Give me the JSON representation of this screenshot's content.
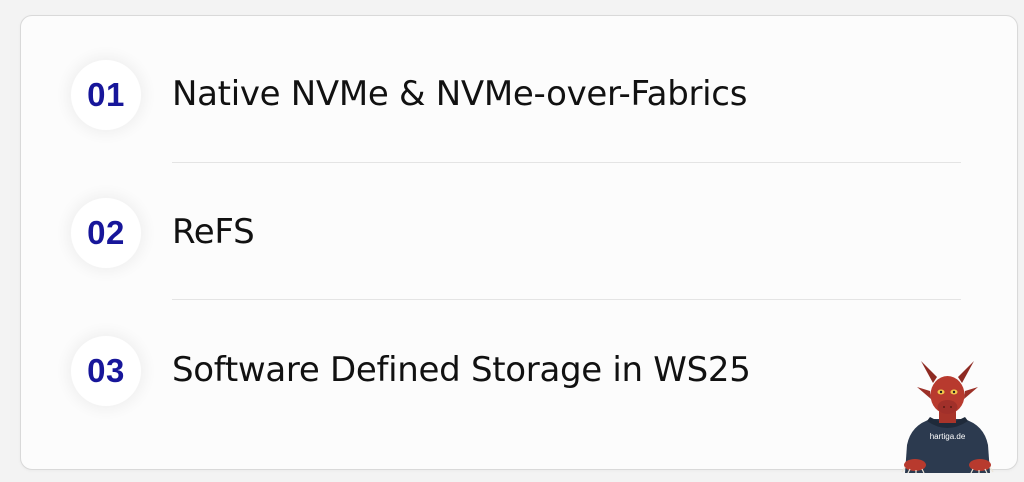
{
  "items": [
    {
      "number": "01",
      "label": "Native NVMe & NVMe-over-Fabrics"
    },
    {
      "number": "02",
      "label": "ReFS"
    },
    {
      "number": "03",
      "label": "Software Defined Storage in WS25"
    }
  ],
  "mascot": {
    "text": "hartiga.de"
  },
  "colors": {
    "number": "#17169a",
    "label": "#111111",
    "card_background": "#fcfcfc",
    "page_background": "#f3f3f3"
  }
}
